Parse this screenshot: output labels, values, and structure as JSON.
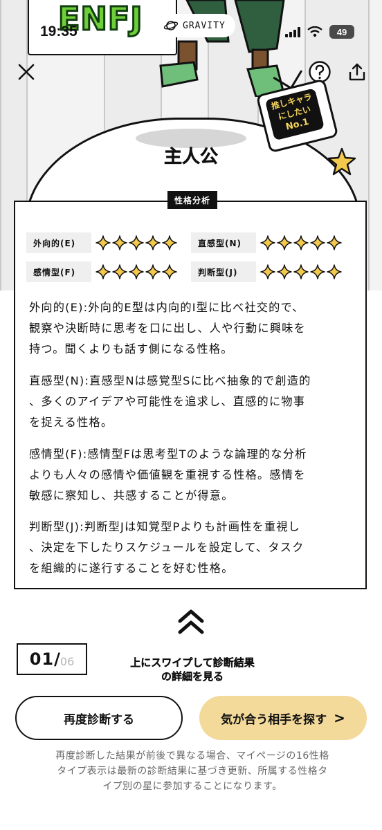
{
  "status_bar": {
    "time": "19:35",
    "battery": "49"
  },
  "header": {
    "logo": "ENFJ",
    "app_name": "GRAVITY",
    "character_name": "主人公",
    "tv_badge": {
      "line1": "推しキャラ",
      "line2": "にしたい",
      "line3": "No.1"
    }
  },
  "analysis": {
    "tag": "性格分析",
    "traits": [
      {
        "label": "外向的(E)",
        "stars": 5
      },
      {
        "label": "直感型(N)",
        "stars": 5
      },
      {
        "label": "感情型(F)",
        "stars": 5
      },
      {
        "label": "判断型(J)",
        "stars": 5
      }
    ],
    "descriptions": [
      {
        "l1": "外向的(E):外向的E型は内向的I型に比べ社交的で、",
        "l2": "観察や決断時に思考を口に出し、人や行動に興味を",
        "l3": "持つ。聞くよりも話す側になる性格。"
      },
      {
        "l1": "直感型(N):直感型Nは感覚型Sに比べ抽象的で創造的",
        "l2": "、多くのアイデアや可能性を追求し、直感的に物事",
        "l3": "を捉える性格。"
      },
      {
        "l1": "感情型(F):感情型Fは思考型Tのような論理的な分析",
        "l2": "よりも人々の感情や価値観を重視する性格。感情を",
        "l3": "敏感に察知し、共感することが得意。"
      },
      {
        "l1": "判断型(J):判断型Jは知覚型Pよりも計画性を重視し",
        "l2": "、決定を下したりスケジュールを設定して、タスク",
        "l3": "を組織的に遂行することを好む性格。"
      }
    ]
  },
  "pager": {
    "current": "01",
    "separator": "/",
    "total": "06"
  },
  "swipe_hint": {
    "line1": "上にスワイプして診断結果",
    "line2": "の詳細を見る"
  },
  "buttons": {
    "retry": "再度診断する",
    "match": "気が合う相手を探す",
    "match_arrow": ">"
  },
  "note": {
    "l1": "再度診断した結果が前後で異なる場合、マイページの16性格",
    "l2": "タイプ表示は最新の診断結果に基づき更新、所属する性格タ",
    "l3": "イプ別の星に参加することになります。"
  },
  "colors": {
    "accent_gold": "#f3d99a",
    "logo_green": "#6fcf3a",
    "star_gold": "#f2c94c"
  }
}
